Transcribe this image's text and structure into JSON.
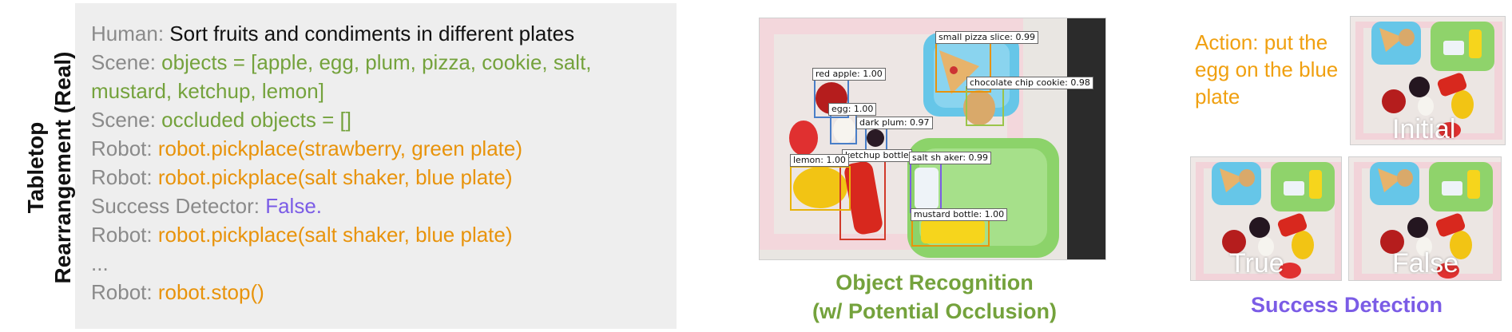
{
  "side_title": {
    "line1": "Tabletop",
    "line2": "Rearrangement (Real)"
  },
  "transcript": [
    {
      "prefix": "Human: ",
      "text": "Sort fruits and condiments in different plates",
      "color": "black"
    },
    {
      "prefix": "Scene: ",
      "text": "objects = [apple, egg, plum, pizza, cookie, salt,",
      "color": "green"
    },
    {
      "prefix": "",
      "text": "mustard, ketchup, lemon]",
      "color": "green"
    },
    {
      "prefix": "Scene: ",
      "text": "occluded objects = []",
      "color": "green"
    },
    {
      "prefix": "Robot: ",
      "text": "robot.pickplace(strawberry, green plate)",
      "color": "orange"
    },
    {
      "prefix": "Robot: ",
      "text": "robot.pickplace(salt shaker, blue plate)",
      "color": "orange"
    },
    {
      "prefix": "Success Detector: ",
      "text": "False.",
      "color": "purple"
    },
    {
      "prefix": "Robot: ",
      "text": "robot.pickplace(salt shaker, blue plate)",
      "color": "orange"
    },
    {
      "prefix": "...",
      "text": "",
      "color": "gray"
    },
    {
      "prefix": "Robot: ",
      "text": "robot.stop()",
      "color": "orange"
    }
  ],
  "detections": [
    {
      "label": "small pizza slice: 0.99",
      "color": "#e8930b"
    },
    {
      "label": "chocolate chip cookie: 0.98",
      "color": "#9bc44a"
    },
    {
      "label": "red apple: 1.00",
      "color": "#4a7fc8"
    },
    {
      "label": "egg: 1.00",
      "color": "#4a7fc8"
    },
    {
      "label": "dark plum: 0.97",
      "color": "#4a7fc8"
    },
    {
      "label": "ketchup bottle",
      "color": "#d13a2a"
    },
    {
      "label": "salt sh aker: 0.99",
      "color": "#7b5ce6"
    },
    {
      "label": "lemon: 1.00",
      "color": "#e8b30b"
    },
    {
      "label": "mustard bottle: 1.00",
      "color": "#e8930b"
    }
  ],
  "object_caption": {
    "line1": "Object Recognition",
    "line2": "(w/ Potential Occlusion)",
    "color": "#74a23c"
  },
  "action_text": "Action: put the egg on the blue plate",
  "thumbnails": {
    "initial": "Initial",
    "true": "True",
    "false": "False"
  },
  "success_caption": {
    "text": "Success Detection",
    "color": "#7b5ce6"
  }
}
